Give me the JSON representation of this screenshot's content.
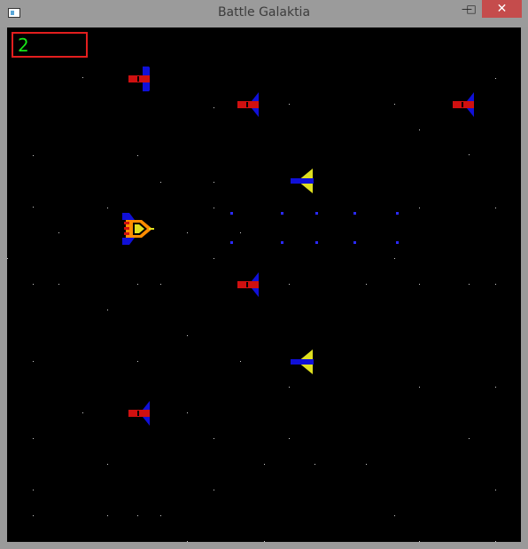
{
  "window": {
    "title": "Battle Galaktia",
    "minimize_glyph": "—",
    "maximize_glyph": "□",
    "close_glyph": "✕"
  },
  "game": {
    "score": "2",
    "colors": {
      "background": "#000000",
      "score_border": "#e31e1e",
      "score_text": "#18e618",
      "enemy_body": "#d01010",
      "enemy_fin": "#1010d8",
      "fighter_wing": "#e0e020",
      "fighter_body": "#1010d8",
      "player_body": "#ff8c00",
      "bullet": "#2a2aff"
    }
  }
}
